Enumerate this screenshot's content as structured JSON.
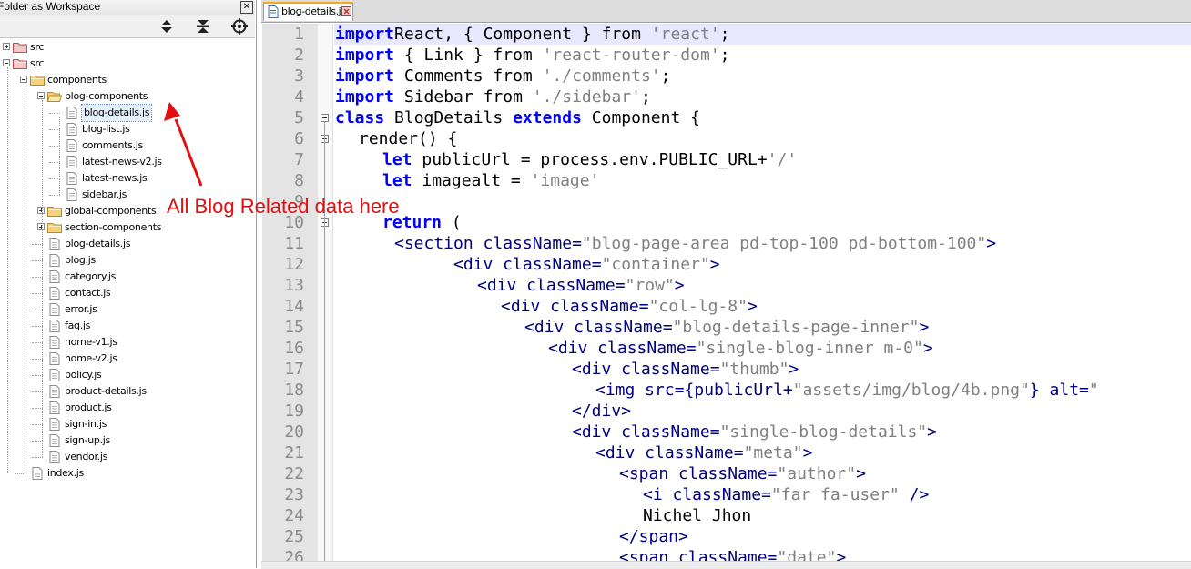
{
  "workspace": {
    "title": "Folder as Workspace",
    "toolbar": [
      "expand-all-icon",
      "collapse-all-icon",
      "locate-current-file-icon"
    ],
    "tree": [
      {
        "label": "src",
        "depth": 0,
        "kind": "folder-red",
        "toggle": "plus"
      },
      {
        "label": "src",
        "depth": 0,
        "kind": "folder-red",
        "toggle": "minus"
      },
      {
        "label": "components",
        "depth": 1,
        "kind": "folder",
        "toggle": "minus"
      },
      {
        "label": "blog-components",
        "depth": 2,
        "kind": "folder-open",
        "toggle": "minus"
      },
      {
        "label": "blog-details.js",
        "depth": 3,
        "kind": "file",
        "selected": true
      },
      {
        "label": "blog-list.js",
        "depth": 3,
        "kind": "file"
      },
      {
        "label": "comments.js",
        "depth": 3,
        "kind": "file"
      },
      {
        "label": "latest-news-v2.js",
        "depth": 3,
        "kind": "file"
      },
      {
        "label": "latest-news.js",
        "depth": 3,
        "kind": "file"
      },
      {
        "label": "sidebar.js",
        "depth": 3,
        "kind": "file"
      },
      {
        "label": "global-components",
        "depth": 2,
        "kind": "folder",
        "toggle": "plus"
      },
      {
        "label": "section-components",
        "depth": 2,
        "kind": "folder",
        "toggle": "plus"
      },
      {
        "label": "blog-details.js",
        "depth": 2,
        "kind": "file"
      },
      {
        "label": "blog.js",
        "depth": 2,
        "kind": "file"
      },
      {
        "label": "category.js",
        "depth": 2,
        "kind": "file"
      },
      {
        "label": "contact.js",
        "depth": 2,
        "kind": "file"
      },
      {
        "label": "error.js",
        "depth": 2,
        "kind": "file"
      },
      {
        "label": "faq.js",
        "depth": 2,
        "kind": "file"
      },
      {
        "label": "home-v1.js",
        "depth": 2,
        "kind": "file"
      },
      {
        "label": "home-v2.js",
        "depth": 2,
        "kind": "file"
      },
      {
        "label": "policy.js",
        "depth": 2,
        "kind": "file"
      },
      {
        "label": "product-details.js",
        "depth": 2,
        "kind": "file"
      },
      {
        "label": "product.js",
        "depth": 2,
        "kind": "file"
      },
      {
        "label": "sign-in.js",
        "depth": 2,
        "kind": "file"
      },
      {
        "label": "sign-up.js",
        "depth": 2,
        "kind": "file"
      },
      {
        "label": "vendor.js",
        "depth": 2,
        "kind": "file"
      },
      {
        "label": "index.js",
        "depth": 1,
        "kind": "file"
      }
    ]
  },
  "editor": {
    "tab": {
      "label": "blog-details.js",
      "icon": "file-saved-icon",
      "close_icon": "close-tab-icon"
    },
    "lines": [
      {
        "n": "1",
        "indent": 0,
        "fold": "",
        "tokens": [
          [
            "kw",
            "import"
          ],
          [
            "",
            "React, { Component } from "
          ],
          [
            "st",
            "'react'"
          ],
          [
            "",
            ";"
          ]
        ]
      },
      {
        "n": "2",
        "indent": 0,
        "fold": "",
        "tokens": [
          [
            "kw",
            "import"
          ],
          [
            "",
            " { Link } from "
          ],
          [
            "st",
            "'react-router-dom'"
          ],
          [
            "",
            ";"
          ]
        ]
      },
      {
        "n": "3",
        "indent": 0,
        "fold": "",
        "tokens": [
          [
            "kw",
            "import"
          ],
          [
            "",
            " Comments from "
          ],
          [
            "st",
            "'./comments'"
          ],
          [
            "",
            ";"
          ]
        ]
      },
      {
        "n": "4",
        "indent": 0,
        "fold": "",
        "tokens": [
          [
            "kw",
            "import"
          ],
          [
            "",
            " Sidebar from "
          ],
          [
            "st",
            "'./sidebar'"
          ],
          [
            "",
            ";"
          ]
        ]
      },
      {
        "n": "5",
        "indent": 0,
        "fold": "open",
        "tokens": [
          [
            "kw",
            "class"
          ],
          [
            "",
            " BlogDetails "
          ],
          [
            "kw",
            "extends"
          ],
          [
            "",
            " Component {"
          ]
        ]
      },
      {
        "n": "6",
        "indent": 2,
        "fold": "open",
        "tokens": [
          [
            "",
            "render() {"
          ]
        ]
      },
      {
        "n": "7",
        "indent": 4,
        "fold": "",
        "tokens": [
          [
            "kw",
            "let"
          ],
          [
            "",
            " publicUrl = process.env.PUBLIC_URL+"
          ],
          [
            "st",
            "'/'"
          ]
        ]
      },
      {
        "n": "8",
        "indent": 4,
        "fold": "",
        "tokens": [
          [
            "kw",
            "let"
          ],
          [
            "",
            " imagealt = "
          ],
          [
            "st",
            "'image'"
          ]
        ]
      },
      {
        "n": "9",
        "indent": 0,
        "fold": "",
        "tokens": []
      },
      {
        "n": "10",
        "indent": 4,
        "fold": "open",
        "tokens": [
          [
            "kw",
            "return"
          ],
          [
            "",
            " ("
          ]
        ]
      },
      {
        "n": "11",
        "indent": 5,
        "fold": "",
        "tokens": [
          [
            "tg",
            "<section className="
          ],
          [
            "st",
            "\"blog-page-area pd-top-100 pd-bottom-100\""
          ],
          [
            "tg",
            ">"
          ]
        ]
      },
      {
        "n": "12",
        "indent": 10,
        "fold": "",
        "tokens": [
          [
            "tg",
            "<div className="
          ],
          [
            "st",
            "\"container\""
          ],
          [
            "tg",
            ">"
          ]
        ]
      },
      {
        "n": "13",
        "indent": 12,
        "fold": "",
        "tokens": [
          [
            "tg",
            "<div className="
          ],
          [
            "st",
            "\"row\""
          ],
          [
            "tg",
            ">"
          ]
        ]
      },
      {
        "n": "14",
        "indent": 14,
        "fold": "",
        "tokens": [
          [
            "tg",
            "<div className="
          ],
          [
            "st",
            "\"col-lg-8\""
          ],
          [
            "tg",
            ">"
          ]
        ]
      },
      {
        "n": "15",
        "indent": 16,
        "fold": "",
        "tokens": [
          [
            "tg",
            "<div className="
          ],
          [
            "st",
            "\"blog-details-page-inner\""
          ],
          [
            "tg",
            ">"
          ]
        ]
      },
      {
        "n": "16",
        "indent": 18,
        "fold": "",
        "tokens": [
          [
            "tg",
            "<div className="
          ],
          [
            "st",
            "\"single-blog-inner m-0\""
          ],
          [
            "tg",
            ">"
          ]
        ]
      },
      {
        "n": "17",
        "indent": 20,
        "fold": "",
        "tokens": [
          [
            "tg",
            "<div className="
          ],
          [
            "st",
            "\"thumb\""
          ],
          [
            "tg",
            ">"
          ]
        ]
      },
      {
        "n": "18",
        "indent": 22,
        "fold": "",
        "tokens": [
          [
            "tg",
            "<img src={publicUrl+"
          ],
          [
            "st",
            "\"assets/img/blog/4b.png\""
          ],
          [
            "tg",
            "} alt="
          ],
          [
            "st",
            "\""
          ]
        ]
      },
      {
        "n": "19",
        "indent": 20,
        "fold": "",
        "tokens": [
          [
            "tg",
            "</div>"
          ]
        ]
      },
      {
        "n": "20",
        "indent": 20,
        "fold": "",
        "tokens": [
          [
            "tg",
            "<div className="
          ],
          [
            "st",
            "\"single-blog-details\""
          ],
          [
            "tg",
            ">"
          ]
        ]
      },
      {
        "n": "21",
        "indent": 22,
        "fold": "",
        "tokens": [
          [
            "tg",
            "<div className="
          ],
          [
            "st",
            "\"meta\""
          ],
          [
            "tg",
            ">"
          ]
        ]
      },
      {
        "n": "22",
        "indent": 24,
        "fold": "",
        "tokens": [
          [
            "tg",
            "<span className="
          ],
          [
            "st",
            "\"author\""
          ],
          [
            "tg",
            ">"
          ]
        ]
      },
      {
        "n": "23",
        "indent": 26,
        "fold": "",
        "tokens": [
          [
            "tg",
            "<i className="
          ],
          [
            "st",
            "\"far fa-user\""
          ],
          [
            "tg",
            " />"
          ]
        ]
      },
      {
        "n": "24",
        "indent": 26,
        "fold": "",
        "tokens": [
          [
            "",
            "Nichel Jhon"
          ]
        ]
      },
      {
        "n": "25",
        "indent": 24,
        "fold": "",
        "tokens": [
          [
            "tg",
            "</span>"
          ]
        ]
      },
      {
        "n": "26",
        "indent": 24,
        "fold": "",
        "tokens": [
          [
            "tg",
            "<span className="
          ],
          [
            "st",
            "\"date\""
          ],
          [
            "tg",
            ">"
          ]
        ]
      }
    ]
  },
  "annotation": {
    "text": "All Blog Related data here",
    "color": "#e01010"
  },
  "colors": {
    "keyword": "#0000ff",
    "string": "#808080",
    "tag": "#000080",
    "current_line": "#e8e8ff",
    "gutter": "#e4e4e4",
    "selected_item": "#e5f0ff"
  }
}
